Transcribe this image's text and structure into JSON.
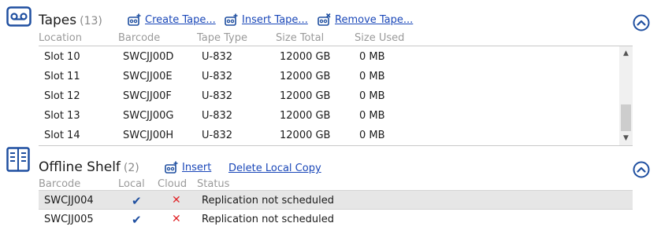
{
  "tapes": {
    "icon": "tape-cassette-icon",
    "title": "Tapes",
    "count": "(13)",
    "actions": {
      "create": "Create Tape...",
      "insert": "Insert Tape...",
      "remove": "Remove Tape..."
    },
    "columns": [
      "Location",
      "Barcode",
      "Tape Type",
      "Size Total",
      "Size Used"
    ],
    "rows": [
      {
        "location": "Slot 10",
        "barcode": "SWCJJ00D",
        "type": "U-832",
        "size_total": "12000 GB",
        "size_used": "0 MB"
      },
      {
        "location": "Slot 11",
        "barcode": "SWCJJ00E",
        "type": "U-832",
        "size_total": "12000 GB",
        "size_used": "0 MB"
      },
      {
        "location": "Slot 12",
        "barcode": "SWCJJ00F",
        "type": "U-832",
        "size_total": "12000 GB",
        "size_used": "0 MB"
      },
      {
        "location": "Slot 13",
        "barcode": "SWCJJ00G",
        "type": "U-832",
        "size_total": "12000 GB",
        "size_used": "0 MB"
      },
      {
        "location": "Slot 14",
        "barcode": "SWCJJ00H",
        "type": "U-832",
        "size_total": "12000 GB",
        "size_used": "0 MB"
      }
    ]
  },
  "offline_shelf": {
    "icon": "shelf-icon",
    "title": "Offline Shelf",
    "count": "(2)",
    "actions": {
      "insert": "Insert",
      "delete_local": "Delete Local Copy"
    },
    "columns": [
      "Barcode",
      "Local",
      "Cloud",
      "Status"
    ],
    "rows": [
      {
        "barcode": "SWCJJ004",
        "local": "✔",
        "cloud": "✕",
        "status": "Replication not scheduled"
      },
      {
        "barcode": "SWCJJ005",
        "local": "✔",
        "cloud": "✕",
        "status": "Replication not scheduled"
      }
    ]
  },
  "colors": {
    "link": "#1a47b8",
    "check": "#1f4fa0",
    "cross": "#e0262a",
    "selected_row": "#e6e6e6"
  }
}
